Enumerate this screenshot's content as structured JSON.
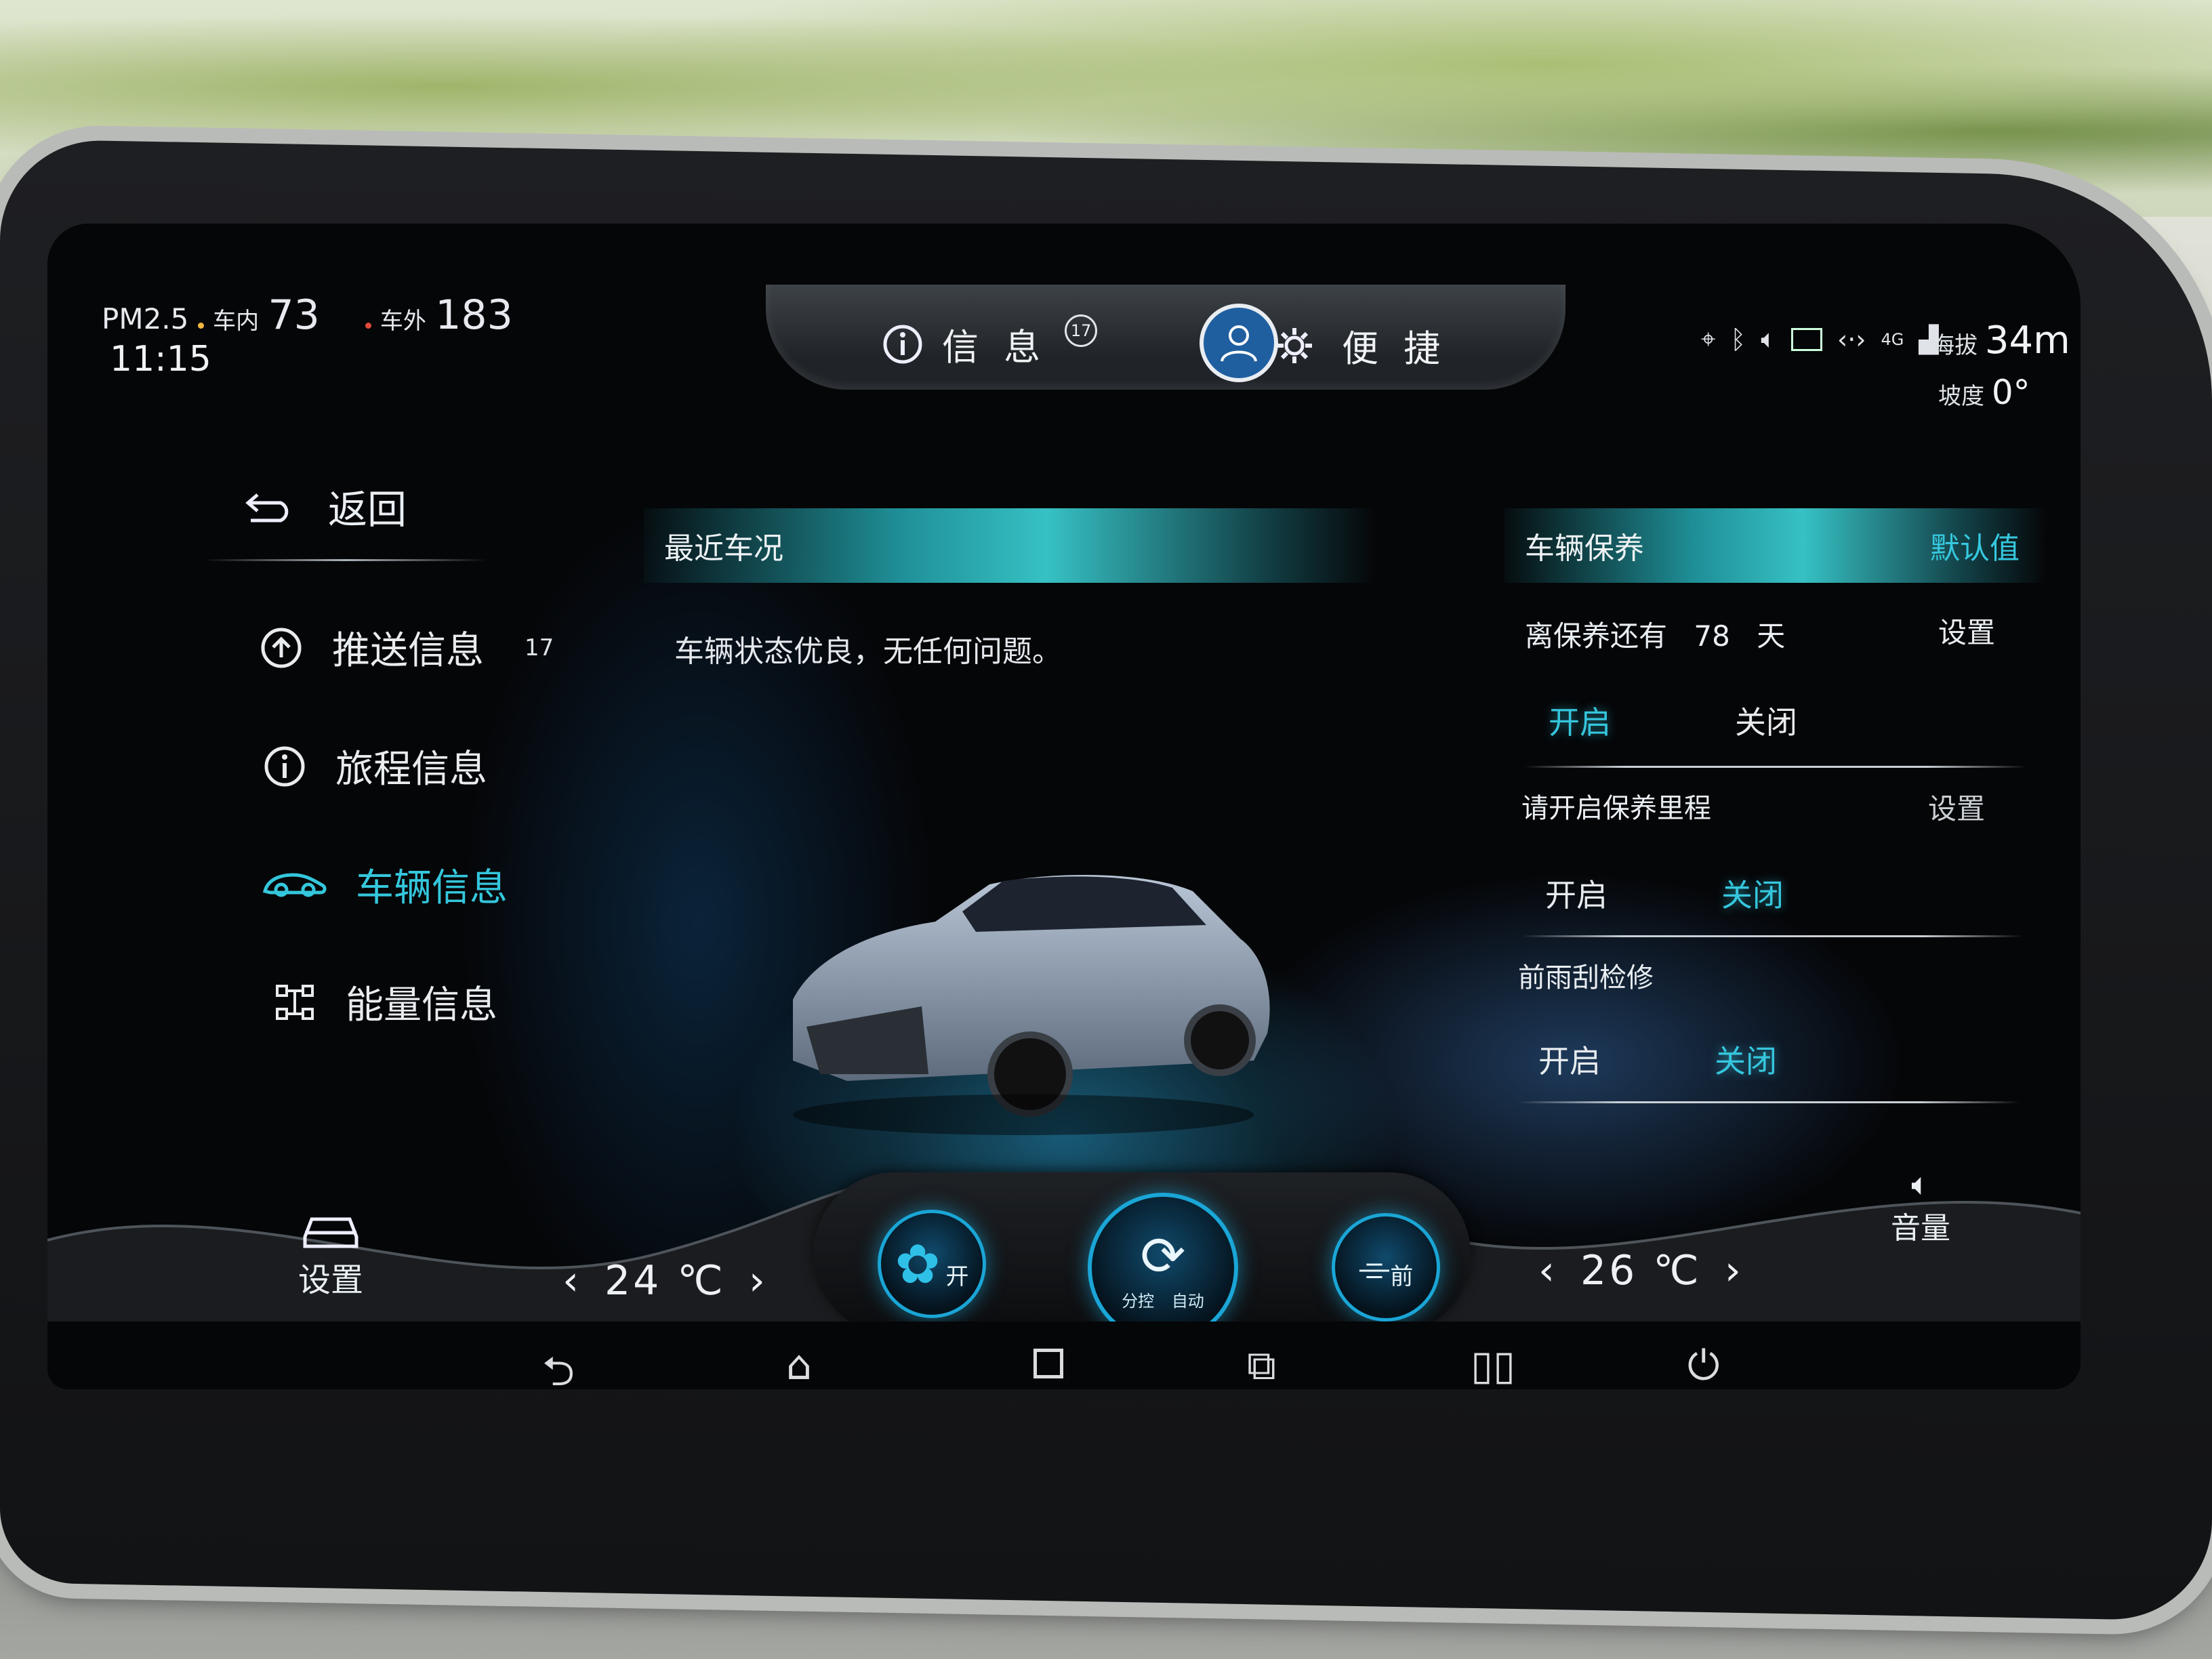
{
  "status_bar": {
    "pm_label": "PM2.5",
    "inside_label": "车内",
    "inside_value": "73",
    "outside_label": "车外",
    "outside_value": "183",
    "time": "11:15",
    "network": "4G",
    "altitude_label": "海拔",
    "altitude_value": "34m",
    "slope_label": "坡度",
    "slope_value": "0°"
  },
  "top_tabs": {
    "info_label": "信 息",
    "info_badge": "17",
    "convenience_label": "便 捷"
  },
  "sidebar": {
    "back_label": "返回",
    "items": [
      {
        "label": "推送信息",
        "badge": "17",
        "active": false
      },
      {
        "label": "旅程信息",
        "active": false
      },
      {
        "label": "车辆信息",
        "active": true
      },
      {
        "label": "能量信息",
        "active": false
      }
    ]
  },
  "recent": {
    "title": "最近车况",
    "status": "车辆状态优良，无任何问题。"
  },
  "maintenance": {
    "title": "车辆保养",
    "default_label": "默认值",
    "sections": [
      {
        "label": "离保养还有",
        "value": "78",
        "unit": "天",
        "set_label": "设置",
        "on_label": "开启",
        "off_label": "关闭",
        "selected": "on"
      },
      {
        "label": "请开启保养里程",
        "set_label": "设置",
        "on_label": "开启",
        "off_label": "关闭",
        "selected": "off"
      },
      {
        "label": "前雨刮检修",
        "on_label": "开启",
        "off_label": "关闭",
        "selected": "off"
      }
    ]
  },
  "climate": {
    "settings_label": "设置",
    "left_temp": "24 ℃",
    "right_temp": "26 ℃",
    "fan_label": "开",
    "split_label": "分控",
    "auto_label": "自动",
    "defrost_label": "前",
    "volume_label": "音量"
  },
  "colors": {
    "accent": "#34c7dc",
    "background": "#050608"
  }
}
